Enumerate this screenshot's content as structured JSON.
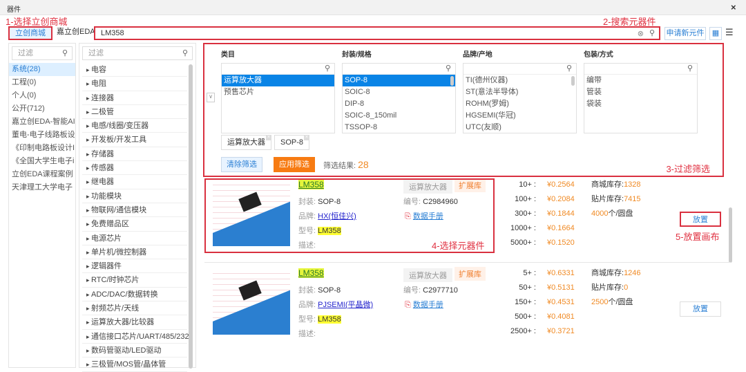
{
  "window": {
    "title": "器件",
    "close": "×"
  },
  "annotations": {
    "a1": "1-选择立创商城",
    "a2": "2-搜索元器件",
    "a3": "3-过滤筛选",
    "a4": "4-选择元器件",
    "a5": "5-放置画布"
  },
  "tabs": [
    "立创商城",
    "嘉立创EDA"
  ],
  "search": {
    "value": "LM358",
    "clear": "⊗",
    "icon": "search-icon"
  },
  "toolbar": {
    "apply_new": "申请新元件"
  },
  "libs": {
    "placeholder": "过滤",
    "items": [
      "系统(28)",
      "工程(0)",
      "个人(0)",
      "公开(712)",
      "嘉立创EDA-智能AI",
      "董电-电子线路板设",
      "《印制电路板设计I",
      "《全国大学生电子i",
      "立创EDA课程案例",
      "天津理工大学电子"
    ]
  },
  "categories": {
    "placeholder": "过滤",
    "items": [
      "电容",
      "电阻",
      "连接器",
      "二极管",
      "电感/线圈/变压器",
      "开发板/开发工具",
      "存储器",
      "传感器",
      "继电器",
      "功能模块",
      "物联网/通信模块",
      "免费赠品区",
      "电源芯片",
      "单片机/微控制器",
      "逻辑器件",
      "RTC/时钟芯片",
      "ADC/DAC/数据转换",
      "射频芯片/天线",
      "运算放大器/比较器",
      "通信接口芯片/UART/485/232",
      "数码管驱动/LED驱动",
      "三极管/MOS管/晶体管"
    ]
  },
  "filters": {
    "columns": [
      {
        "title": "类目",
        "items": [
          "运算放大器",
          "预售芯片"
        ],
        "selected": 0
      },
      {
        "title": "封装/规格",
        "items": [
          "SOP-8",
          "SOIC-8",
          "DIP-8",
          "SOIC-8_150mil",
          "TSSOP-8"
        ],
        "selected": 0
      },
      {
        "title": "品牌/产地",
        "items": [
          "TI(德州仪器)",
          "ST(意法半导体)",
          "ROHM(罗姆)",
          "HGSEMI(华冠)",
          "UTC(友顺)"
        ],
        "selected": -1
      },
      {
        "title": "包装/方式",
        "items": [
          "编带",
          "管装",
          "袋装"
        ],
        "selected": -1
      }
    ],
    "chips": [
      "运算放大器",
      "SOP-8"
    ],
    "clear": "清除筛选",
    "apply": "应用筛选",
    "result_label": "筛选结果:",
    "result_count": "28"
  },
  "labels": {
    "package": "封装:",
    "code": "编号:",
    "brand": "品牌:",
    "model": "型号:",
    "desc": "描述:",
    "datasheet": "数据手册",
    "mall_stock": "商城库存:",
    "smt_stock": "贴片库存:",
    "place": "放置",
    "cat_tag": "运算放大器",
    "ext_tag": "扩展库"
  },
  "products": [
    {
      "name": "LM358",
      "package": "SOP-8",
      "code": "C2984960",
      "brand": "HX(恒佳兴)",
      "model": "LM358",
      "tiers": [
        "10+ :",
        "100+ :",
        "300+ :",
        "1000+ :",
        "5000+ :"
      ],
      "prices": [
        "¥0.2564",
        "¥0.2084",
        "¥0.1844",
        "¥0.1664",
        "¥0.1520"
      ],
      "mall_stock": "1328",
      "smt_stock": "7415",
      "reel_qty": "4000",
      "reel_unit": "个/圆盘"
    },
    {
      "name": "LM358",
      "package": "SOP-8",
      "code": "C2977710",
      "brand": "PJSEMI(平晶微)",
      "model": "LM358",
      "tiers": [
        "5+ :",
        "50+ :",
        "150+ :",
        "500+ :",
        "2500+ :"
      ],
      "prices": [
        "¥0.6331",
        "¥0.5131",
        "¥0.4531",
        "¥0.4081",
        "¥0.3721"
      ],
      "mall_stock": "1246",
      "smt_stock": "0",
      "reel_qty": "2500",
      "reel_unit": "个/圆盘"
    }
  ]
}
